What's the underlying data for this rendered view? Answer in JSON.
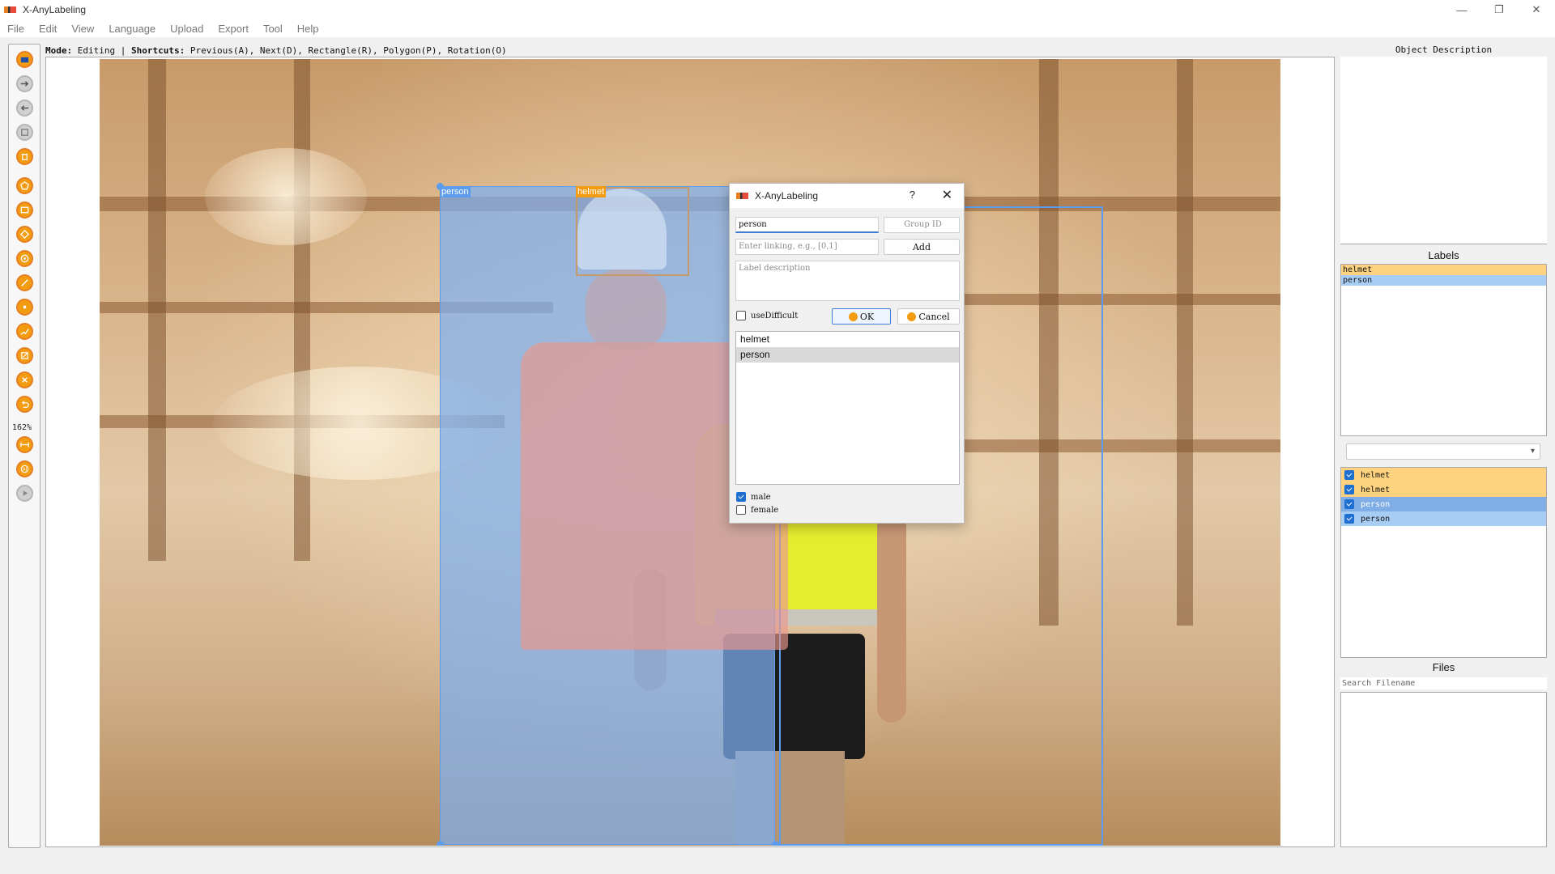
{
  "window": {
    "title": "X-AnyLabeling",
    "min": "—",
    "restore": "❐",
    "close": "✕"
  },
  "menu": [
    "File",
    "Edit",
    "View",
    "Language",
    "Upload",
    "Export",
    "Tool",
    "Help"
  ],
  "toolbar": {
    "zoom": "162%",
    "tools": [
      {
        "name": "open-folder-icon",
        "color": "orange"
      },
      {
        "name": "next-arrow-icon",
        "color": "gray"
      },
      {
        "name": "prev-arrow-icon",
        "color": "gray"
      },
      {
        "name": "save-icon",
        "color": "gray"
      },
      {
        "name": "delete-file-icon",
        "color": "orange"
      },
      {
        "name": "polygon-icon",
        "color": "orange"
      },
      {
        "name": "rectangle-icon",
        "color": "orange"
      },
      {
        "name": "rotation-icon",
        "color": "orange"
      },
      {
        "name": "circle-icon",
        "color": "orange"
      },
      {
        "name": "line-icon",
        "color": "orange"
      },
      {
        "name": "point-icon",
        "color": "orange"
      },
      {
        "name": "linestrip-icon",
        "color": "orange"
      },
      {
        "name": "edit-icon",
        "color": "orange"
      },
      {
        "name": "delete-shape-icon",
        "color": "orange"
      },
      {
        "name": "undo-icon",
        "color": "orange"
      },
      {
        "name": "fit-width-icon",
        "color": "orange"
      },
      {
        "name": "ai-icon",
        "color": "orange"
      },
      {
        "name": "play-icon",
        "color": "gray"
      }
    ]
  },
  "modebar": {
    "mode_key": "Mode:",
    "mode_val": " Editing | ",
    "shortcuts_key": "Shortcuts:",
    "shortcuts_val": " Previous(A), Next(D), Rectangle(R), Polygon(P), Rotation(O)"
  },
  "canvas": {
    "boxes": [
      {
        "label": "person",
        "color": "#5d9cec"
      },
      {
        "label": "helmet",
        "color": "#f39c12"
      }
    ]
  },
  "dialog": {
    "title": "X-AnyLabeling",
    "help": "?",
    "close": "✕",
    "label_value": "person",
    "group_id_placeholder": "Group ID",
    "linking_placeholder": "Enter linking, e.g., [0,1]",
    "add_label": "Add",
    "description_placeholder": "Label description",
    "difficult_label": "useDifficult",
    "ok_label": "OK",
    "cancel_label": "Cancel",
    "list": [
      "helmet",
      "person"
    ],
    "attributes": [
      {
        "label": "male",
        "checked": true
      },
      {
        "label": "female",
        "checked": false
      }
    ]
  },
  "right_panel": {
    "description_title": "Object Description",
    "labels_title": "Labels",
    "labels": [
      {
        "name": "helmet",
        "color": "#ffd27f"
      },
      {
        "name": "person",
        "color": "#a8cdf5"
      }
    ],
    "shapes": [
      {
        "name": "helmet",
        "checked": true,
        "color": "#ffd27f"
      },
      {
        "name": "helmet",
        "checked": true,
        "color": "#ffd27f"
      },
      {
        "name": "person",
        "checked": true,
        "color": "#7faee6"
      },
      {
        "name": "person",
        "checked": true,
        "color": "#a8cdf5"
      }
    ],
    "files_title": "Files",
    "files_search_placeholder": "Search Filename"
  }
}
